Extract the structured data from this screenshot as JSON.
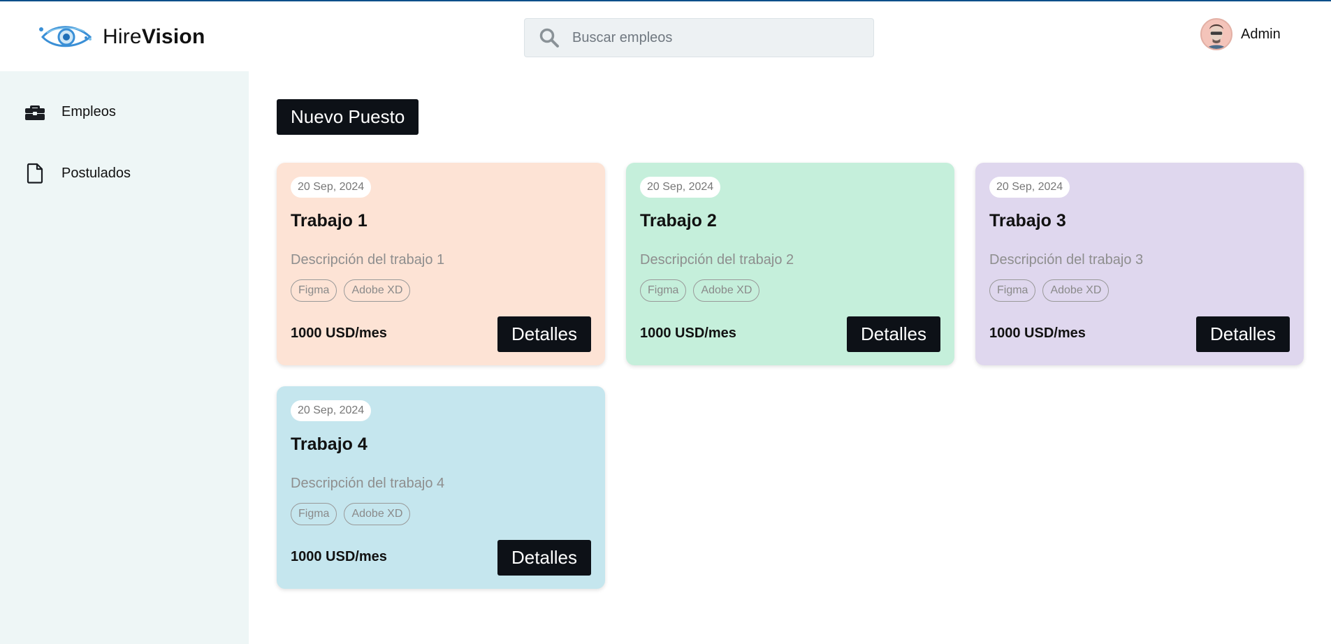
{
  "header": {
    "brand_light": "Hire",
    "brand_bold": "Vision",
    "search_placeholder": "Buscar empleos",
    "user_name": "Admin"
  },
  "sidebar": {
    "items": [
      {
        "label": "Empleos",
        "icon": "briefcase-icon"
      },
      {
        "label": "Postulados",
        "icon": "file-icon"
      }
    ]
  },
  "main": {
    "new_button": "Nuevo Puesto",
    "jobs": [
      {
        "date": "20 Sep, 2024",
        "title": "Trabajo 1",
        "description": "Descripción del trabajo 1",
        "tags": [
          "Figma",
          "Adobe XD"
        ],
        "salary": "1000 USD/mes",
        "button": "Detalles",
        "color": "#fde3d5"
      },
      {
        "date": "20 Sep, 2024",
        "title": "Trabajo 2",
        "description": "Descripción del trabajo 2",
        "tags": [
          "Figma",
          "Adobe XD"
        ],
        "salary": "1000 USD/mes",
        "button": "Detalles",
        "color": "#c5efdb"
      },
      {
        "date": "20 Sep, 2024",
        "title": "Trabajo 3",
        "description": "Descripción del trabajo 3",
        "tags": [
          "Figma",
          "Adobe XD"
        ],
        "salary": "1000 USD/mes",
        "button": "Detalles",
        "color": "#dfd7ee"
      },
      {
        "date": "20 Sep, 2024",
        "title": "Trabajo 4",
        "description": "Descripción del trabajo 4",
        "tags": [
          "Figma",
          "Adobe XD"
        ],
        "salary": "1000 USD/mes",
        "button": "Detalles",
        "color": "#c5e6ee"
      }
    ]
  },
  "colors": {
    "accent_dark": "#0d1117",
    "sidebar_bg": "#eef6f6",
    "logo_blue": "#3a8fd6"
  }
}
